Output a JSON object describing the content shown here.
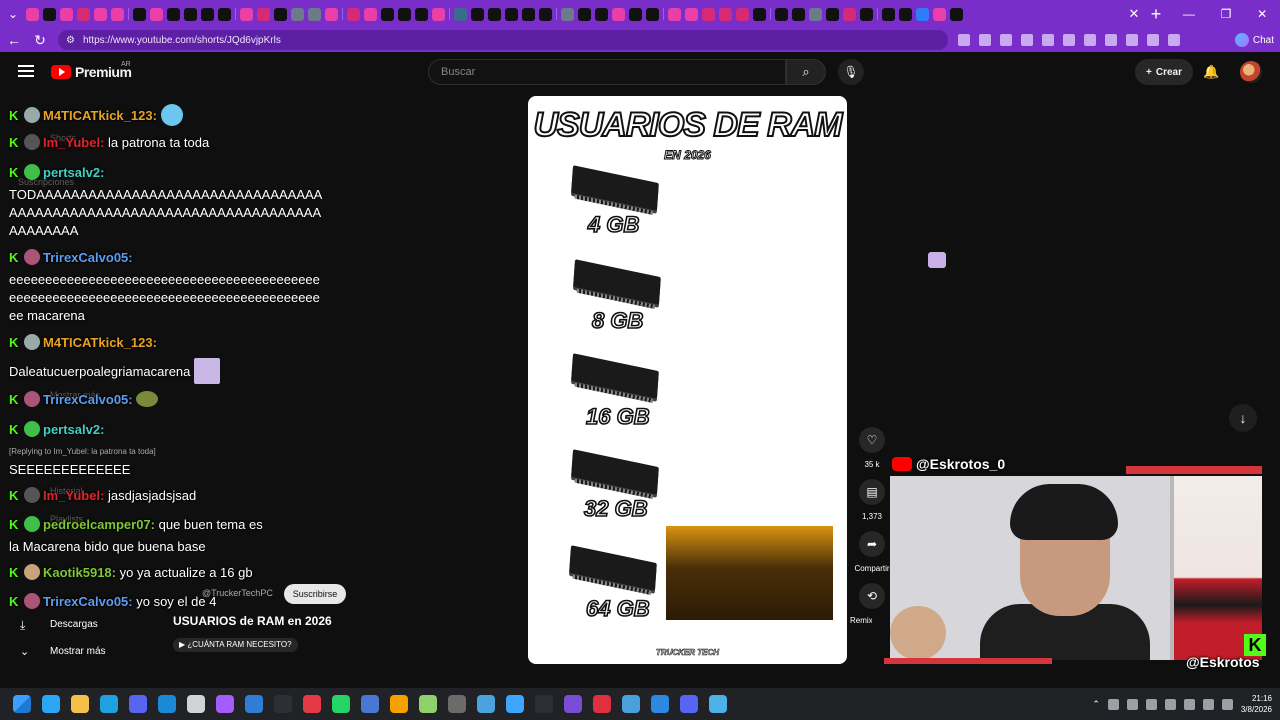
{
  "browser": {
    "url": "https://www.youtube.com/shorts/JQd6vjpKrls",
    "chat_label": "Chat",
    "tab_fav_colors": [
      "#e83fa8",
      "#111",
      "#e83fa8",
      "#d62976",
      "#e83fa8",
      "#e83fa8",
      "#111",
      "#e83fa8",
      "#111",
      "#111",
      "#111",
      "#111",
      "#e83fa8",
      "#d62976",
      "#111",
      "#6c7a89",
      "#6c7a89",
      "#e83fa8",
      "#d62976",
      "#e83fa8",
      "#111",
      "#111",
      "#111",
      "#e83fa8",
      "#3a6b8a",
      "#111",
      "#111",
      "#111",
      "#111",
      "#111",
      "#6c7a89",
      "#111",
      "#111",
      "#e83fa8",
      "#111",
      "#111",
      "#e83fa8",
      "#e83fa8",
      "#d62976",
      "#d62976",
      "#d62976",
      "#111",
      "#111",
      "#111",
      "#6c7a89",
      "#111",
      "#d62976",
      "#111",
      "#111",
      "#111",
      "#2f7cf6",
      "#e83fa8",
      "#111"
    ]
  },
  "youtube": {
    "brand": "Premium",
    "country": "AR",
    "search_placeholder": "Buscar",
    "create_label": "Crear"
  },
  "sidebar_ghost": {
    "shorts": "Shorts",
    "subscriptions": "Suscripciones",
    "show_more": "Mostrar más",
    "downloads": "Descargas",
    "show_more_bottom": "Mostrar más",
    "history": "Historial",
    "playlists": "Playlists"
  },
  "chat": [
    {
      "user": "M4TICATkick_123:",
      "color": "#e8a325",
      "text": ""
    },
    {
      "user": "Im_Yubel:",
      "color": "#e0242b",
      "text": "la patrona ta toda"
    },
    {
      "user": "pertsalv2:",
      "color": "#3fd1c1",
      "text": ""
    },
    {
      "user": "TrirexCalvo05:",
      "color": "#5b9df0",
      "text": ""
    },
    {
      "user": "M4TICATkick_123:",
      "color": "#e8a325",
      "text": ""
    },
    {
      "user": "TrirexCalvo05:",
      "color": "#5b9df0",
      "text": ""
    },
    {
      "user": "pertsalv2:",
      "color": "#3fd1c1",
      "text": ""
    },
    {
      "user": "Im_Yubel:",
      "color": "#e0242b",
      "text": "jasdjasjadsjsad"
    },
    {
      "user": "pedroelcamper07:",
      "color": "#7ec832",
      "text": "que buen tema es"
    },
    {
      "user": "Kaotik5918:",
      "color": "#7ec832",
      "text": "yo ya actualize a 16 gb"
    },
    {
      "user": "TrirexCalvo05:",
      "color": "#5b9df0",
      "text": "yo soy el de 4"
    }
  ],
  "chat_blocks": {
    "todaa": "TODAAAAAAAAAAAAAAAAAAAAAAAAAAAAAAAAAAAAAAAAAAAAAAAAAAAAAAAAAAAAAAAAAAAAAAAAAAAAA",
    "eee": "eeeeeeeeeeeeeeeeeeeeeeeeeeeeeeeeeeeeeeeeeeeeeeeeeeeeeeeeeeeeeeeeeeeeeeeeeeeeeeeeeeeeeeee macarena",
    "dale": "Daleatucuerpoalegriamacarena",
    "reply": "[Replying to Im_Yubel: la patrona ta toda]",
    "see": "SEEEEEEEEEEEEE",
    "macarena": "la Macarena bido que buena base"
  },
  "short": {
    "title": "USUARIOS DE RAM",
    "subtitle": "EN 2026",
    "ram_labels": [
      "4 GB",
      "8 GB",
      "16 GB",
      "32 GB",
      "64 GB"
    ],
    "footer": "TRUCKER TECH",
    "video_title": "USUARIOS de RAM en 2026",
    "channel": "@TruckerTechPC",
    "subscribe": "Suscribirse",
    "tag": "¿CUÁNTA RAM NECESITO?"
  },
  "actions": {
    "likes": "35 k",
    "comments": "1,373",
    "share": "Compartir",
    "remix": "Remix"
  },
  "stream": {
    "handle_top": "@Eskrotos_0",
    "handle_bottom": "@Eskrotos",
    "kick_color": "#53fc18",
    "accent_red": "#d4363c"
  },
  "taskbar": {
    "time": "21:16",
    "date": "3/8/2026",
    "icon_colors": [
      "#2aa6f5",
      "#f5c04a",
      "#1fa0e0",
      "#5865f2",
      "#1b8ad6",
      "#cfd3d6",
      "#a45cff",
      "#2f7dd6",
      "#2b2f36",
      "#e63946",
      "#25d366",
      "#4a77d4",
      "#f4a100",
      "#8fd16a",
      "#6b6b6b",
      "#4aa3df",
      "#3ea6ff",
      "#2b2f36",
      "#7a4dd6",
      "#e0303f",
      "#4b9fdc",
      "#2d88e0",
      "#5865f2",
      "#4bb1e6"
    ]
  }
}
